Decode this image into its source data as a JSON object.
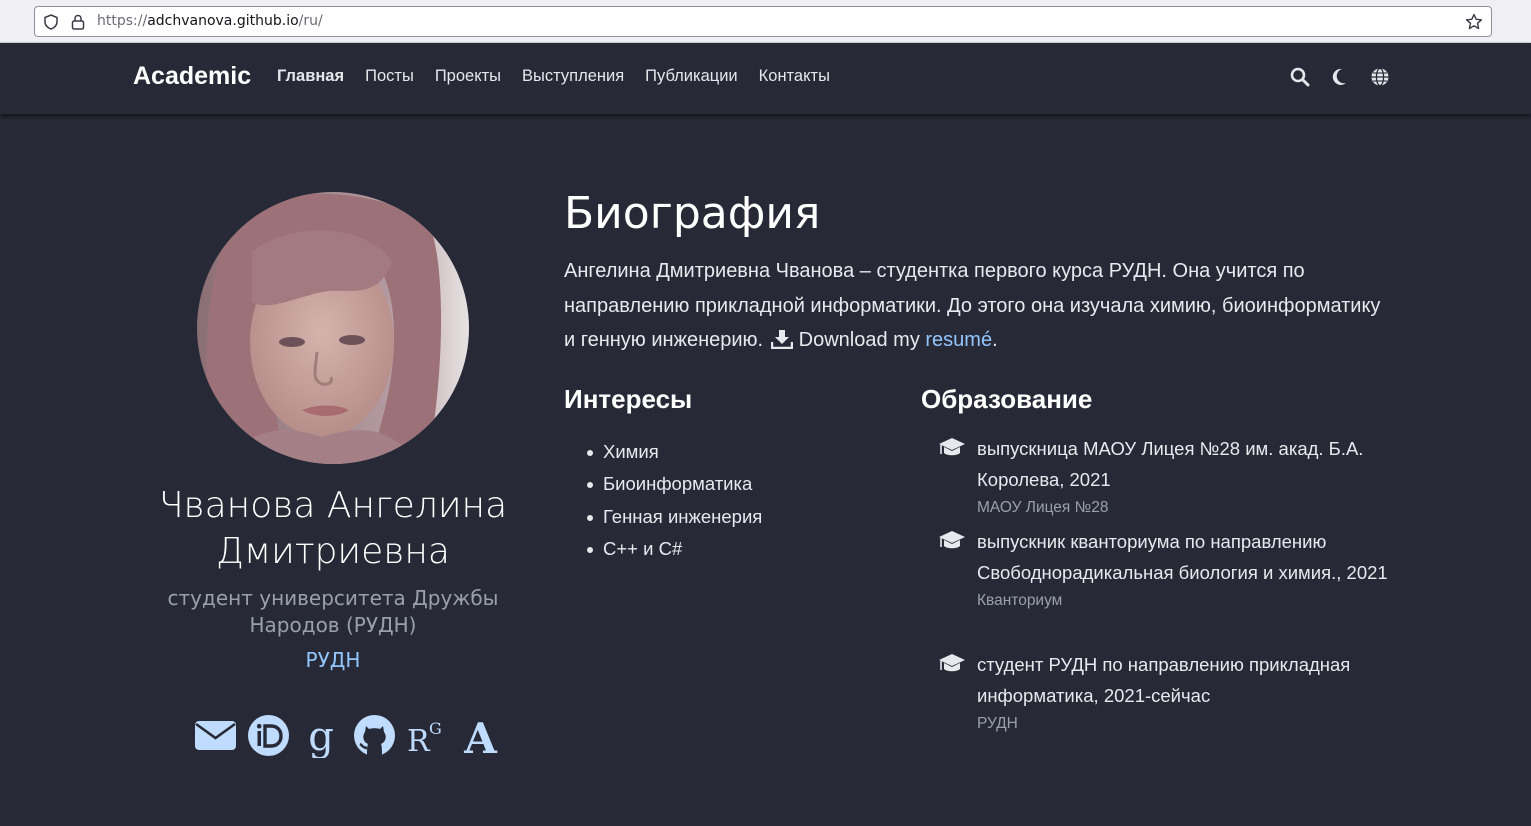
{
  "browser": {
    "url_prefix": "https://",
    "url_host": "adchvanova.github.io",
    "url_path": "/ru/"
  },
  "navbar": {
    "brand": "Academic",
    "links": [
      "Главная",
      "Посты",
      "Проекты",
      "Выступления",
      "Публикации",
      "Контакты"
    ],
    "active_index": 0,
    "icons": [
      "search-icon",
      "moon-icon",
      "globe-icon"
    ]
  },
  "profile": {
    "name": "Чванова Ангелина Дмитриевна",
    "role": "студент университета Дружбы Народов (РУДН)",
    "organization": "РУДН",
    "social_icons": [
      "envelope-icon",
      "orcid-icon",
      "google-scholar-icon",
      "github-icon",
      "researchgate-icon",
      "academia-icon"
    ]
  },
  "biography": {
    "title": "Биография",
    "text": "Ангелина Дмитриевна Чванова – студентка первого курса РУДН. Она учится по направлению прикладной информатики. До этого она изучала химию, биоинформатику и генную инженерию.",
    "download_text": "Download my",
    "resume_link": "resumé",
    "after_link": "."
  },
  "interests": {
    "title": "Интересы",
    "items": [
      "Химия",
      "Биоинформатика",
      "Генная инженерия",
      "C++ и C#"
    ]
  },
  "education": {
    "title": "Образование",
    "items": [
      {
        "course": "выпускница МАОУ Лицея №28 им. акад. Б.А. Королева, 2021",
        "institution": "МАОУ Лицея №28"
      },
      {
        "course": "выпускник кванториума по направлению Свободнорадикальная биология и химия., 2021",
        "institution": "Кванториум"
      },
      {
        "course": "студент РУДН по направлению прикладная информатика, 2021-сейчас",
        "institution": "РУДН"
      }
    ]
  },
  "colors": {
    "background": "#272a36",
    "accent": "#93c5fd",
    "muted": "#9aa0ab"
  }
}
